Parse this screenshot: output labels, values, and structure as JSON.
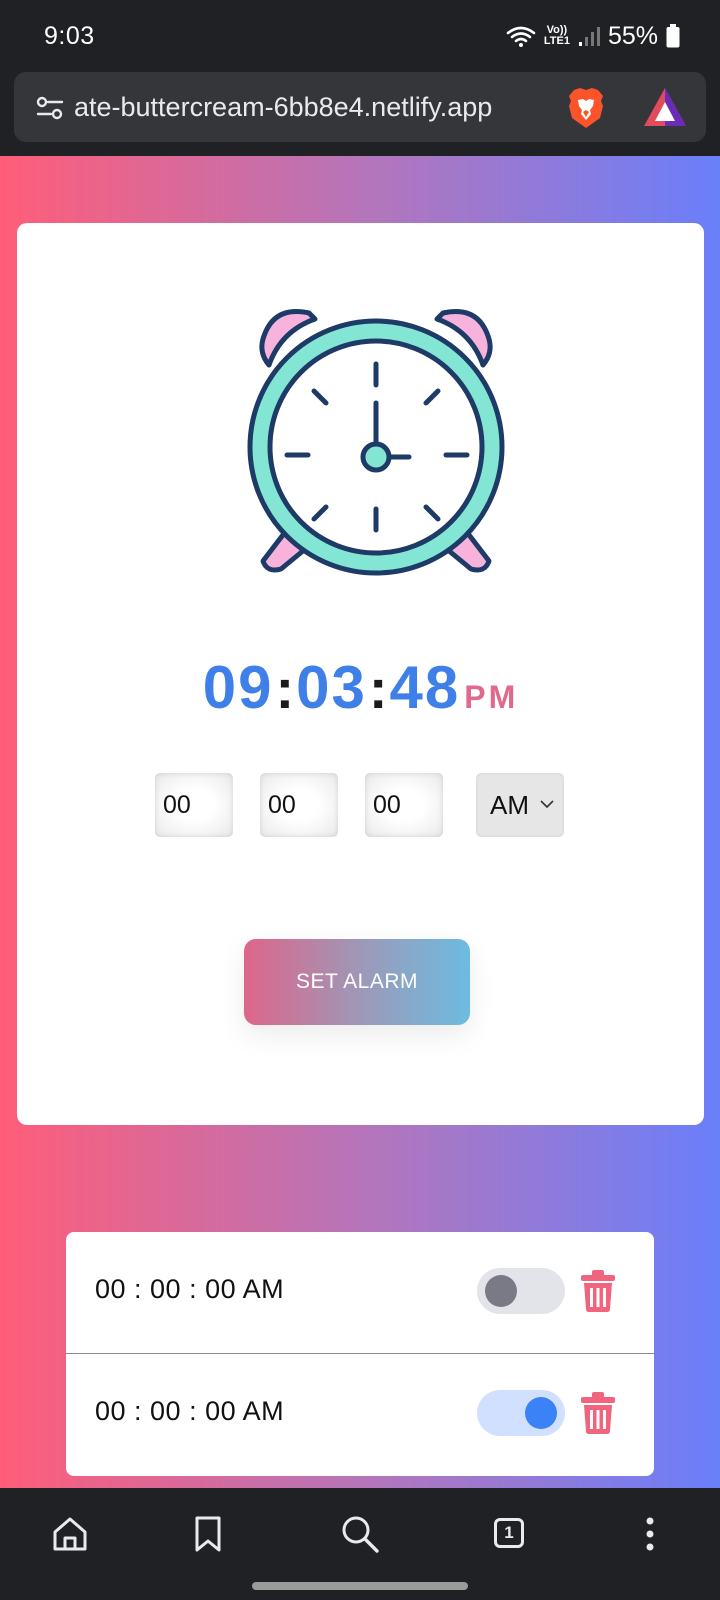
{
  "status_bar": {
    "time": "9:03",
    "battery": "55%",
    "network_top": "Vo))",
    "network_bottom": "LTE1"
  },
  "browser": {
    "url": "ate-buttercream-6bb8e4.netlify.app",
    "icons": [
      "site-settings-icon",
      "brave-shields-icon",
      "brave-rewards-icon"
    ]
  },
  "clock": {
    "hours": "09",
    "minutes": "03",
    "seconds": "48",
    "separator": ":",
    "ampm": "PM",
    "colors": {
      "digits": "#3f80e8",
      "ampm": "#e06a8c",
      "face_ring": "#83e6d5",
      "bells": "#f7b3dc",
      "outline": "#1e3a66"
    }
  },
  "alarm_form": {
    "hour_value": "00",
    "minute_value": "00",
    "second_value": "00",
    "ampm_value": "AM",
    "set_button_label": "SET ALARM"
  },
  "alarms": [
    {
      "time": "00 : 00 : 00 AM",
      "enabled": false
    },
    {
      "time": "00 : 00 : 00 AM",
      "enabled": true
    }
  ],
  "bottom_nav": {
    "tab_count": "1",
    "items": [
      "home-icon",
      "bookmark-icon",
      "search-icon",
      "tabs-icon",
      "more-icon"
    ]
  },
  "theme": {
    "gradient_start": "#ff5d79",
    "gradient_end": "#6a7ffa",
    "button_gradient_start": "#dd6689",
    "button_gradient_end": "#6cbce0"
  }
}
